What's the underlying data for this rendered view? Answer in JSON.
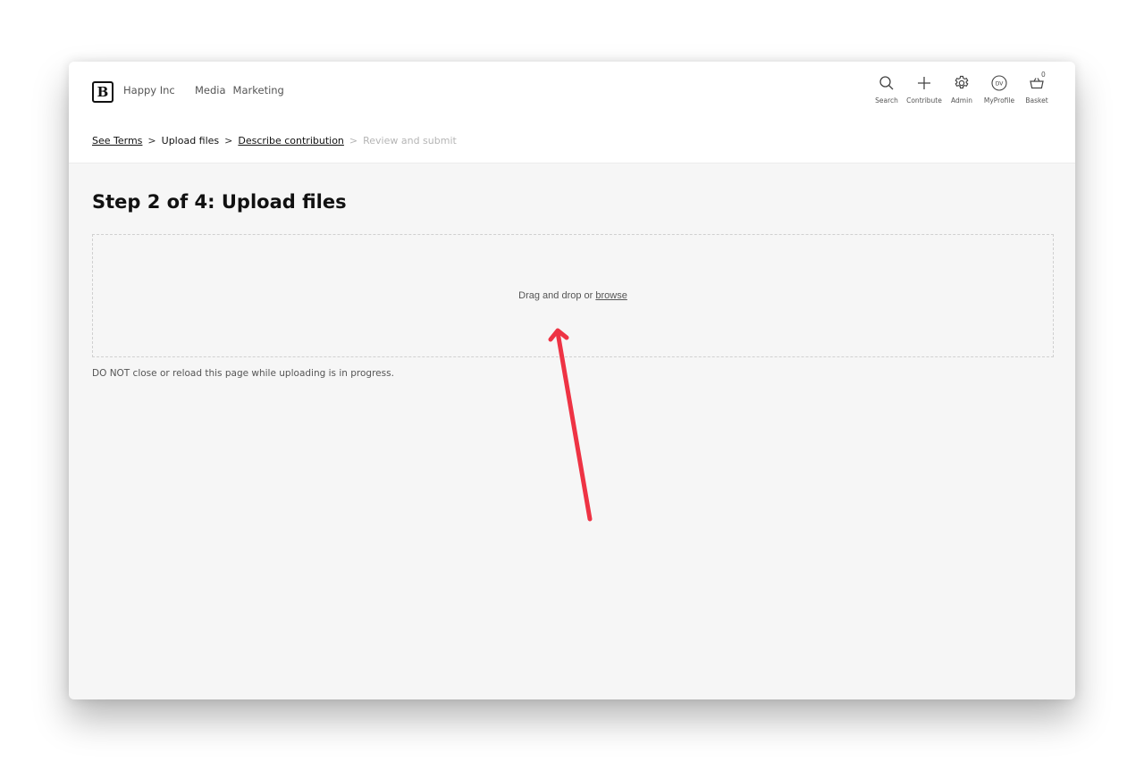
{
  "header": {
    "brand": "Happy Inc",
    "nav": [
      "Media",
      "Marketing"
    ],
    "tools": [
      {
        "icon": "search-icon",
        "label": "Search"
      },
      {
        "icon": "plus-icon",
        "label": "Contribute"
      },
      {
        "icon": "gear-icon",
        "label": "Admin"
      },
      {
        "icon": "avatar-icon",
        "label": "MyProfile",
        "initials": "DV"
      },
      {
        "icon": "basket-icon",
        "label": "Basket",
        "count": "0"
      }
    ]
  },
  "breadcrumb": {
    "steps": [
      {
        "label": "See Terms",
        "state": "link"
      },
      {
        "label": "Upload files",
        "state": "current"
      },
      {
        "label": "Describe contribution",
        "state": "link"
      },
      {
        "label": "Review and submit",
        "state": "future"
      }
    ],
    "separator": ">"
  },
  "main": {
    "title": "Step 2 of 4: Upload files",
    "dropzone": {
      "text": "Drag and drop or",
      "browse_label": "browse"
    },
    "warning": "DO NOT close or reload this page while uploading is in progress."
  },
  "annotation": {
    "arrow_color": "#ee3344"
  }
}
